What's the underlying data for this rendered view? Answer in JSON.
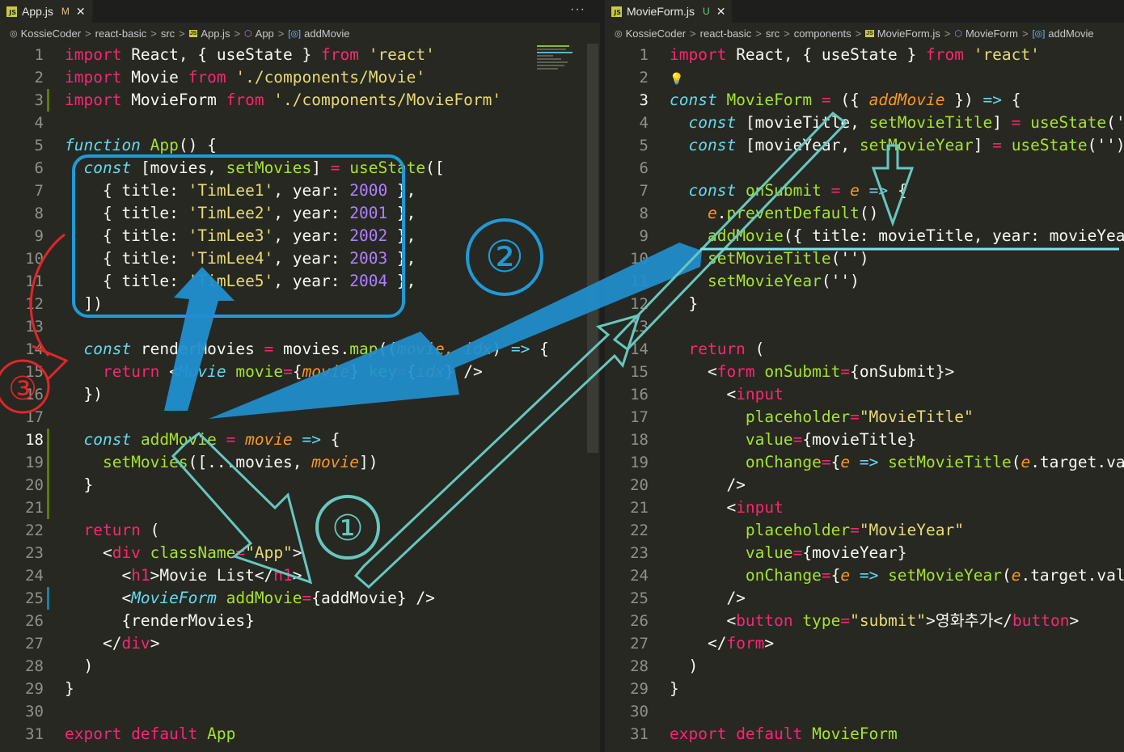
{
  "left": {
    "tab": {
      "name": "App.js",
      "status": "M",
      "close": "✕",
      "more": "···"
    },
    "breadcrumb": [
      "KossieCoder",
      "react-basic",
      "src",
      "App.js",
      "App",
      "addMovie"
    ],
    "lines": [
      [
        [
          "import ",
          "kw"
        ],
        [
          "React, { useState } ",
          "tx"
        ],
        [
          "from ",
          "kw"
        ],
        [
          "'react'",
          "str"
        ]
      ],
      [
        [
          "import ",
          "kw"
        ],
        [
          "Movie ",
          "tx"
        ],
        [
          "from ",
          "kw"
        ],
        [
          "'./components/Movie'",
          "str"
        ]
      ],
      [
        [
          "import ",
          "kw"
        ],
        [
          "MovieForm ",
          "tx"
        ],
        [
          "from ",
          "kw"
        ],
        [
          "'./components/MovieForm'",
          "str"
        ]
      ],
      [],
      [
        [
          "function ",
          "sto"
        ],
        [
          "App",
          "fn"
        ],
        [
          "() {",
          "tx"
        ]
      ],
      [
        [
          "  "
        ],
        [
          "const ",
          "sto"
        ],
        [
          "[movies, ",
          "tx"
        ],
        [
          "setMovies",
          "fn"
        ],
        [
          "] ",
          "tx"
        ],
        [
          "= ",
          "kw"
        ],
        [
          "useState",
          "fn"
        ],
        [
          "([",
          "tx"
        ]
      ],
      [
        [
          "    { title: ",
          "tx"
        ],
        [
          "'TimLee1'",
          "str"
        ],
        [
          ", year: ",
          "tx"
        ],
        [
          "2000",
          "num"
        ],
        [
          " },",
          "tx"
        ]
      ],
      [
        [
          "    { title: ",
          "tx"
        ],
        [
          "'TimLee2'",
          "str"
        ],
        [
          ", year: ",
          "tx"
        ],
        [
          "2001",
          "num"
        ],
        [
          " },",
          "tx"
        ]
      ],
      [
        [
          "    { title: ",
          "tx"
        ],
        [
          "'TimLee3'",
          "str"
        ],
        [
          ", year: ",
          "tx"
        ],
        [
          "2002",
          "num"
        ],
        [
          " },",
          "tx"
        ]
      ],
      [
        [
          "    { title: ",
          "tx"
        ],
        [
          "'TimLee4'",
          "str"
        ],
        [
          ", year: ",
          "tx"
        ],
        [
          "2003",
          "num"
        ],
        [
          " },",
          "tx"
        ]
      ],
      [
        [
          "    { title: ",
          "tx"
        ],
        [
          "'TimLee5'",
          "str"
        ],
        [
          ", year: ",
          "tx"
        ],
        [
          "2004",
          "num"
        ],
        [
          " },",
          "tx"
        ]
      ],
      [
        [
          "  ])",
          "tx"
        ]
      ],
      [],
      [
        [
          "  "
        ],
        [
          "const ",
          "sto"
        ],
        [
          "renderMovies ",
          "tx"
        ],
        [
          "= ",
          "kw"
        ],
        [
          "movies.",
          "tx"
        ],
        [
          "map",
          "fn"
        ],
        [
          "((",
          "tx"
        ],
        [
          "movie, idx",
          "par"
        ],
        [
          ") ",
          "tx"
        ],
        [
          "=> ",
          "sto"
        ],
        [
          "{",
          "tx"
        ]
      ],
      [
        [
          "    "
        ],
        [
          "return ",
          "kw"
        ],
        [
          "<",
          "tx"
        ],
        [
          "Movie ",
          "cls"
        ],
        [
          "movie",
          "fn"
        ],
        [
          "=",
          "kw"
        ],
        [
          "{",
          "tx"
        ],
        [
          "movie",
          "par"
        ],
        [
          "} ",
          "tx"
        ],
        [
          "key",
          "fn"
        ],
        [
          "=",
          "kw"
        ],
        [
          "{",
          "tx"
        ],
        [
          "idx",
          "par"
        ],
        [
          "} />",
          "tx"
        ]
      ],
      [
        [
          "  })",
          "tx"
        ]
      ],
      [],
      [
        [
          "  "
        ],
        [
          "const ",
          "sto"
        ],
        [
          "addMovie",
          "fn"
        ],
        [
          " = ",
          "kw"
        ],
        [
          "movie ",
          "par"
        ],
        [
          "=> ",
          "sto"
        ],
        [
          "{",
          "tx"
        ]
      ],
      [
        [
          "    "
        ],
        [
          "setMovies",
          "fn"
        ],
        [
          "([...movies, ",
          "tx"
        ],
        [
          "movie",
          "par"
        ],
        [
          "])",
          "tx"
        ]
      ],
      [
        [
          "  }",
          "tx"
        ]
      ],
      [],
      [
        [
          "  "
        ],
        [
          "return ",
          "kw"
        ],
        [
          "(",
          "tx"
        ]
      ],
      [
        [
          "    <",
          "tx"
        ],
        [
          "div ",
          "tag"
        ],
        [
          "className",
          "fn"
        ],
        [
          "=",
          "kw"
        ],
        [
          "\"App\"",
          "str"
        ],
        [
          ">",
          "tx"
        ]
      ],
      [
        [
          "      <",
          "tx"
        ],
        [
          "h1",
          "tag"
        ],
        [
          ">Movie List</",
          "tx"
        ],
        [
          "h1",
          "tag"
        ],
        [
          ">",
          "tx"
        ]
      ],
      [
        [
          "      <",
          "tx"
        ],
        [
          "MovieForm ",
          "cls"
        ],
        [
          "addMovie",
          "fn"
        ],
        [
          "=",
          "kw"
        ],
        [
          "{addMovie}",
          "tx"
        ],
        [
          " />",
          "tx"
        ]
      ],
      [
        [
          "      {renderMovies}",
          "tx"
        ]
      ],
      [
        [
          "    </",
          "tx"
        ],
        [
          "div",
          "tag"
        ],
        [
          ">",
          "tx"
        ]
      ],
      [
        [
          "  )",
          "tx"
        ]
      ],
      [
        [
          "}",
          "tx"
        ]
      ],
      [],
      [
        [
          "export ",
          "kw"
        ],
        [
          "default ",
          "kw"
        ],
        [
          "App",
          "fn"
        ]
      ]
    ]
  },
  "right": {
    "tab": {
      "name": "MovieForm.js",
      "status": "U",
      "close": "✕"
    },
    "breadcrumb": [
      "KossieCoder",
      "react-basic",
      "src",
      "components",
      "MovieForm.js",
      "MovieForm",
      "addMovie"
    ],
    "lines": [
      [
        [
          "import ",
          "kw"
        ],
        [
          "React, { useState } ",
          "tx"
        ],
        [
          "from ",
          "kw"
        ],
        [
          "'react'",
          "str"
        ]
      ],
      [
        [
          "💡",
          "bulb"
        ]
      ],
      [
        [
          "const ",
          "sto"
        ],
        [
          "MovieForm ",
          "fn"
        ],
        [
          "= ",
          "kw"
        ],
        [
          "({ ",
          "tx"
        ],
        [
          "addMovie",
          "par"
        ],
        [
          " }) ",
          "tx"
        ],
        [
          "=> ",
          "sto"
        ],
        [
          "{",
          "tx"
        ]
      ],
      [
        [
          "  "
        ],
        [
          "const ",
          "sto"
        ],
        [
          "[movieTitle, ",
          "tx"
        ],
        [
          "setMovieTitle",
          "fn"
        ],
        [
          "] ",
          "tx"
        ],
        [
          "= ",
          "kw"
        ],
        [
          "useState",
          "fn"
        ],
        [
          "('')",
          "tx"
        ]
      ],
      [
        [
          "  "
        ],
        [
          "const ",
          "sto"
        ],
        [
          "[movieYear, ",
          "tx"
        ],
        [
          "setMovieYear",
          "fn"
        ],
        [
          "] ",
          "tx"
        ],
        [
          "= ",
          "kw"
        ],
        [
          "useState",
          "fn"
        ],
        [
          "('')",
          "tx"
        ]
      ],
      [],
      [
        [
          "  "
        ],
        [
          "const ",
          "sto"
        ],
        [
          "onSubmit ",
          "fn"
        ],
        [
          "= ",
          "kw"
        ],
        [
          "e ",
          "par"
        ],
        [
          "=> ",
          "sto"
        ],
        [
          "{",
          "tx"
        ]
      ],
      [
        [
          "    "
        ],
        [
          "e",
          "par"
        ],
        [
          ".",
          "tx"
        ],
        [
          "preventDefault",
          "fn"
        ],
        [
          "()",
          "tx"
        ]
      ],
      [
        [
          "    "
        ],
        [
          "addMovie",
          "fn"
        ],
        [
          "({ title: movieTitle, year: movieYear })",
          "tx"
        ]
      ],
      [
        [
          "    "
        ],
        [
          "setMovieTitle",
          "fn"
        ],
        [
          "('')",
          "tx"
        ]
      ],
      [
        [
          "    "
        ],
        [
          "setMovieYear",
          "fn"
        ],
        [
          "('')",
          "tx"
        ]
      ],
      [
        [
          "  }",
          "tx"
        ]
      ],
      [],
      [
        [
          "  "
        ],
        [
          "return ",
          "kw"
        ],
        [
          "(",
          "tx"
        ]
      ],
      [
        [
          "    <",
          "tx"
        ],
        [
          "form ",
          "tag"
        ],
        [
          "onSubmit",
          "fn"
        ],
        [
          "=",
          "kw"
        ],
        [
          "{onSubmit}>",
          "tx"
        ]
      ],
      [
        [
          "      <",
          "tx"
        ],
        [
          "input",
          "tag"
        ]
      ],
      [
        [
          "        "
        ],
        [
          "placeholder",
          "fn"
        ],
        [
          "=",
          "kw"
        ],
        [
          "\"MovieTitle\"",
          "str"
        ]
      ],
      [
        [
          "        "
        ],
        [
          "value",
          "fn"
        ],
        [
          "=",
          "kw"
        ],
        [
          "{movieTitle}",
          "tx"
        ]
      ],
      [
        [
          "        "
        ],
        [
          "onChange",
          "fn"
        ],
        [
          "=",
          "kw"
        ],
        [
          "{",
          "tx"
        ],
        [
          "e ",
          "par"
        ],
        [
          "=> ",
          "sto"
        ],
        [
          "setMovieTitle",
          "fn"
        ],
        [
          "(",
          "tx"
        ],
        [
          "e",
          "par"
        ],
        [
          ".target.value)}",
          "tx"
        ]
      ],
      [
        [
          "      />",
          "tx"
        ]
      ],
      [
        [
          "      <",
          "tx"
        ],
        [
          "input",
          "tag"
        ]
      ],
      [
        [
          "        "
        ],
        [
          "placeholder",
          "fn"
        ],
        [
          "=",
          "kw"
        ],
        [
          "\"MovieYear\"",
          "str"
        ]
      ],
      [
        [
          "        "
        ],
        [
          "value",
          "fn"
        ],
        [
          "=",
          "kw"
        ],
        [
          "{movieYear}",
          "tx"
        ]
      ],
      [
        [
          "        "
        ],
        [
          "onChange",
          "fn"
        ],
        [
          "=",
          "kw"
        ],
        [
          "{",
          "tx"
        ],
        [
          "e ",
          "par"
        ],
        [
          "=> ",
          "sto"
        ],
        [
          "setMovieYear",
          "fn"
        ],
        [
          "(",
          "tx"
        ],
        [
          "e",
          "par"
        ],
        [
          ".target.value)}",
          "tx"
        ]
      ],
      [
        [
          "      />",
          "tx"
        ]
      ],
      [
        [
          "      <",
          "tx"
        ],
        [
          "button ",
          "tag"
        ],
        [
          "type",
          "fn"
        ],
        [
          "=",
          "kw"
        ],
        [
          "\"submit\"",
          "str"
        ],
        [
          ">영화추가</",
          "tx"
        ],
        [
          "button",
          "tag"
        ],
        [
          ">",
          "tx"
        ]
      ],
      [
        [
          "    </",
          "tx"
        ],
        [
          "form",
          "tag"
        ],
        [
          ">",
          "tx"
        ]
      ],
      [
        [
          "  )",
          "tx"
        ]
      ],
      [
        [
          "}",
          "tx"
        ]
      ],
      [],
      [
        [
          "export ",
          "kw"
        ],
        [
          "default ",
          "kw"
        ],
        [
          "MovieForm",
          "fn"
        ]
      ]
    ]
  },
  "annotations": {
    "circle1": "①",
    "circle2": "②",
    "circle3": "③"
  },
  "colors": {
    "kw": "#f92672",
    "sto": "#66d9ef",
    "fn": "#a6e22e",
    "str": "#e6db74",
    "num": "#ae81ff",
    "par": "#fd971f",
    "tag": "#f92672",
    "cls": "#66d9ef",
    "tx": "#f8f8f2"
  }
}
